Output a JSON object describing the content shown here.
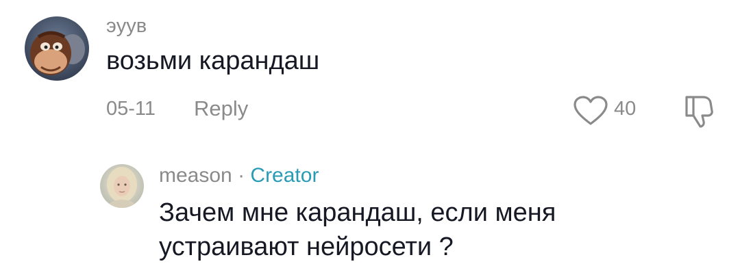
{
  "comments": [
    {
      "username": "эуув",
      "text": "возьми карандаш",
      "date": "05-11",
      "reply_label": "Reply",
      "like_count": "40"
    },
    {
      "username": "meason",
      "separator": "·",
      "badge": "Creator",
      "text_line1": "Зачем мне карандаш, если меня",
      "text_line2": "устраивают нейросети ?"
    }
  ],
  "icons": {
    "like": "heart-outline-icon",
    "dislike": "thumbs-down-icon"
  },
  "colors": {
    "text": "#161823",
    "secondary": "#8a8a8a",
    "creator_badge": "#2a9bb5"
  }
}
